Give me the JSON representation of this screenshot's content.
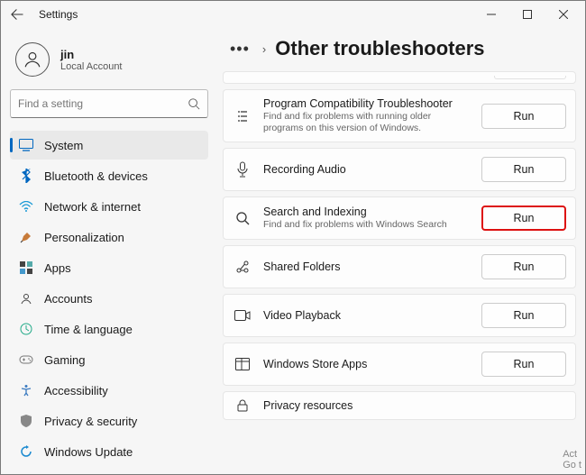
{
  "window": {
    "title": "Settings"
  },
  "user": {
    "name": "jin",
    "type": "Local Account"
  },
  "search": {
    "placeholder": "Find a setting"
  },
  "nav": {
    "items": [
      {
        "label": "System"
      },
      {
        "label": "Bluetooth & devices"
      },
      {
        "label": "Network & internet"
      },
      {
        "label": "Personalization"
      },
      {
        "label": "Apps"
      },
      {
        "label": "Accounts"
      },
      {
        "label": "Time & language"
      },
      {
        "label": "Gaming"
      },
      {
        "label": "Accessibility"
      },
      {
        "label": "Privacy & security"
      },
      {
        "label": "Windows Update"
      }
    ]
  },
  "page": {
    "dots": "•••",
    "chevron": "›",
    "title": "Other troubleshooters"
  },
  "items": [
    {
      "title": "Program Compatibility Troubleshooter",
      "desc": "Find and fix problems with running older programs on this version of Windows.",
      "run": "Run"
    },
    {
      "title": "Recording Audio",
      "desc": "",
      "run": "Run"
    },
    {
      "title": "Search and Indexing",
      "desc": "Find and fix problems with Windows Search",
      "run": "Run"
    },
    {
      "title": "Shared Folders",
      "desc": "",
      "run": "Run"
    },
    {
      "title": "Video Playback",
      "desc": "",
      "run": "Run"
    },
    {
      "title": "Windows Store Apps",
      "desc": "",
      "run": "Run"
    },
    {
      "title": "Privacy resources",
      "desc": "",
      "run": ""
    }
  ],
  "watermark": {
    "l1": "Act",
    "l2": "Go t"
  }
}
